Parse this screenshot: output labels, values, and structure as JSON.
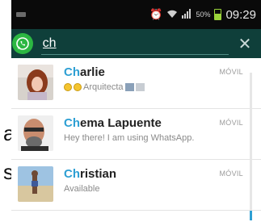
{
  "status_bar": {
    "battery": "50%",
    "time": "09:29"
  },
  "search": {
    "query": "ch"
  },
  "contacts": [
    {
      "name_match": "Ch",
      "name_rest": "arlie",
      "status": "Arquitecta",
      "type": "MÓVIL"
    },
    {
      "name_match": "Ch",
      "name_rest": "ema Lapuente",
      "status": "Hey there! I am using WhatsApp.",
      "type": "MÓVIL"
    },
    {
      "name_match": "Ch",
      "name_rest": "ristian",
      "status": "Available",
      "type": "MÓVIL"
    }
  ],
  "background_fragments": [
    "a",
    "s"
  ],
  "colors": {
    "action_bar": "#0f3f3a",
    "highlight": "#2e9fd3",
    "whatsapp_green": "#2cb742"
  },
  "icons": [
    "back-chevron-icon",
    "whatsapp-logo-icon",
    "clear-icon",
    "alarm-icon",
    "wifi-icon",
    "signal-icon",
    "battery-icon"
  ]
}
